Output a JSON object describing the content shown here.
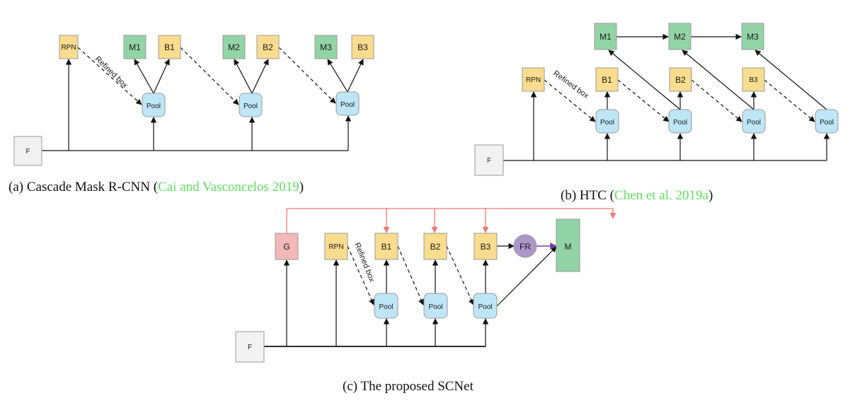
{
  "colors": {
    "box_yellow": "#f9dc8e",
    "box_green": "#93d4a6",
    "box_pool": "#bfe6f6",
    "box_f": "#f2f2f2",
    "box_g": "#f3b8b8",
    "box_fr": "#ac96ca",
    "edge": "#111111",
    "edge_red": "#ee7a72",
    "edge_purple": "#6a3fa0",
    "citation": "#5ee05e",
    "border": "#9a9a9a"
  },
  "panel_a": {
    "caption_prefix": "(a) Cascade Mask R-CNN (",
    "caption_cite": "Cai and Vasconcelos 2019",
    "caption_suffix": ")",
    "nodes": {
      "rpn": "RPN",
      "m1": "M1",
      "b1": "B1",
      "m2": "M2",
      "b2": "B2",
      "m3": "M3",
      "b3": "B3",
      "pool1": "Pool",
      "pool2": "Pool",
      "pool3": "Pool",
      "f": "F"
    },
    "edge_label": "Refined box"
  },
  "panel_b": {
    "caption_prefix": "(b) HTC (",
    "caption_cite": "Chen et al. 2019a",
    "caption_suffix": ")",
    "nodes": {
      "m1": "M1",
      "m2": "M2",
      "m3": "M3",
      "rpn": "RPN",
      "b1": "B1",
      "b2": "B2",
      "b3": "B3",
      "pool1": "Pool",
      "pool2": "Pool",
      "pool3": "Pool",
      "pool4": "Pool",
      "f": "F"
    },
    "edge_label": "Refined box"
  },
  "panel_c": {
    "caption": "(c) The proposed SCNet",
    "nodes": {
      "g": "G",
      "rpn": "RPN",
      "b1": "B1",
      "b2": "B2",
      "b3": "B3",
      "fr": "FR",
      "m": "M",
      "pool1": "Pool",
      "pool2": "Pool",
      "pool3": "Pool",
      "f": "F"
    },
    "edge_label": "Refined box"
  }
}
